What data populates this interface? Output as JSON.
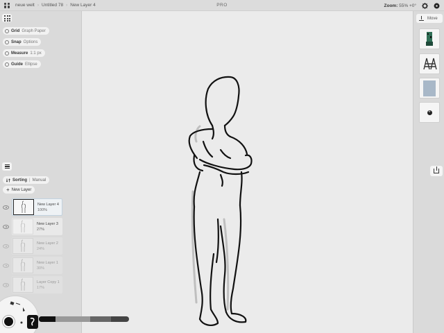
{
  "topbar": {
    "breadcrumbs": [
      "neue welt",
      "Untitled 78",
      "New Layer 4"
    ],
    "center_label": "PRO",
    "zoom_label": "Zoom:",
    "zoom_value": "55% +0°"
  },
  "tools": {
    "grid": {
      "label": "Grid",
      "value": "Graph Paper"
    },
    "snap": {
      "label": "Snap",
      "value": "Options"
    },
    "measure": {
      "label": "Measure",
      "value": "1:1 px"
    },
    "guide": {
      "label": "Guide",
      "value": "Ellipse"
    }
  },
  "layers_panel": {
    "sorting_label": "Sorting",
    "sorting_value": "Manual",
    "new_layer_label": "New Layer",
    "layers": [
      {
        "name": "New Layer 4",
        "opacity": "100%"
      },
      {
        "name": "New Layer 3",
        "opacity": "27%"
      },
      {
        "name": "New Layer 2",
        "opacity": "24%"
      },
      {
        "name": "New Layer 1",
        "opacity": "30%"
      },
      {
        "name": "Layer Copy 1",
        "opacity": "17%"
      }
    ]
  },
  "right_panel": {
    "move_label": "Move",
    "add_symbol": "+"
  },
  "icons": {
    "menu": "grid-dots-icon",
    "settings": "gear-icon",
    "help": "help-icon",
    "layers": "hamburger-icon",
    "eye": "eye-icon",
    "move": "download-icon",
    "export": "share-icon"
  }
}
